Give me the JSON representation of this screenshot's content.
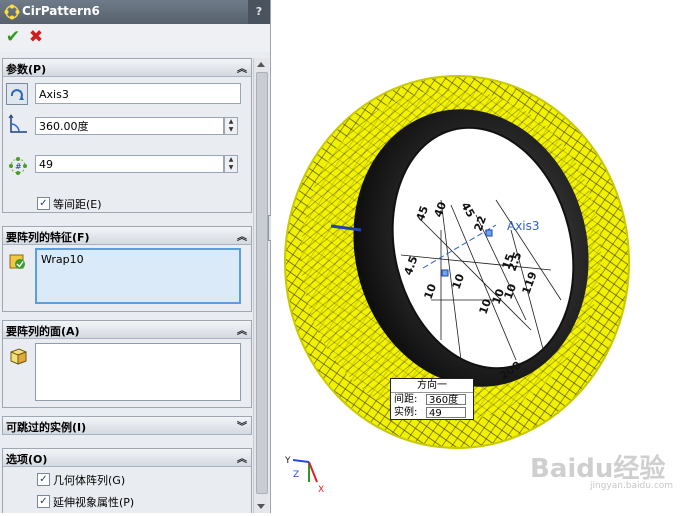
{
  "window": {
    "title": "CirPattern6",
    "help_label": "?"
  },
  "actions": {
    "ok_glyph": "✔",
    "cancel_glyph": "✖"
  },
  "parameters": {
    "header": "参数(P)",
    "axis_value": "Axis3",
    "angle_value": "360.00度",
    "count_value": "49",
    "equal_spacing_label": "等间距(E)",
    "equal_spacing_checked": true
  },
  "features": {
    "header": "要阵列的特征(F)",
    "items": [
      "Wrap10"
    ]
  },
  "faces": {
    "header": "要阵列的面(A)",
    "items": []
  },
  "skip": {
    "header": "可跳过的实例(I)"
  },
  "options": {
    "header": "选项(O)",
    "geometry_pattern_label": "几何体阵列(G)",
    "geometry_pattern_checked": true,
    "propagate_label": "延伸视象属性(P)",
    "propagate_checked": true
  },
  "viewport": {
    "axis_label": "Axis3",
    "callout": {
      "title": "方向一",
      "spacing_label": "间距:",
      "spacing_value": "360度",
      "instances_label": "实例:",
      "instances_value": "49"
    },
    "dims": [
      "45",
      "40",
      "45",
      "4.5",
      "10",
      "10",
      "10",
      "10",
      "10",
      "15",
      "22",
      "119",
      "2.5",
      "200"
    ],
    "triad": {
      "x": "X",
      "y": "Y",
      "z": "Z"
    },
    "watermark": "Baidu经验",
    "watermark_url": "jingyan.baidu.com"
  },
  "colors": {
    "tire_yellow": "#f2f200",
    "tire_black": "#1a1a1a",
    "dim_blue": "#2f62c9",
    "panel_bg": "#e9ecf1"
  },
  "icons": {
    "feature": "circular-pattern-icon",
    "axis": "rotate-arrow-icon",
    "angle": "angle-icon",
    "count": "instance-count-icon",
    "features": "feature-select-icon",
    "faces": "face-cube-icon"
  }
}
